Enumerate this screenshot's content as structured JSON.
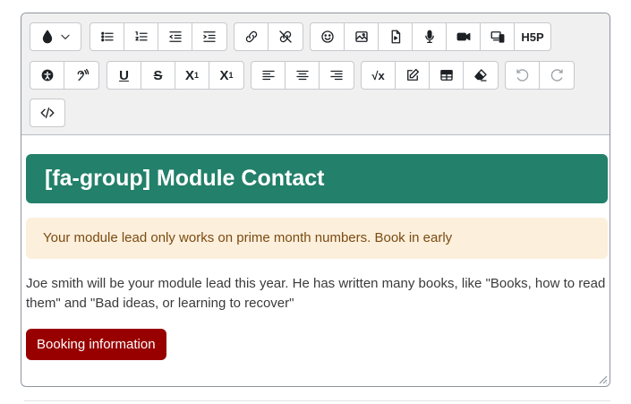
{
  "toolbar": {
    "h5p_label": "H5P",
    "subscript_label": "X",
    "subscript_sub": "1",
    "superscript_label": "X",
    "superscript_sup": "1",
    "underline_label": "U",
    "strike_label": "S",
    "sqrt_label": "√x"
  },
  "content": {
    "banner_title": "[fa-group] Module Contact",
    "alert_text": "Your module lead only works on prime month numbers. Book in early",
    "paragraph": "Joe smith will be your module lead this year. He has written many books, like \"Books, how to read them\" and \"Bad ideas, or learning to recover\"",
    "booking_button": "Booking information"
  },
  "colors": {
    "banner": "#23806a",
    "alert_bg": "#fcefdc",
    "alert_text": "#7a4b11",
    "button": "#980000"
  }
}
